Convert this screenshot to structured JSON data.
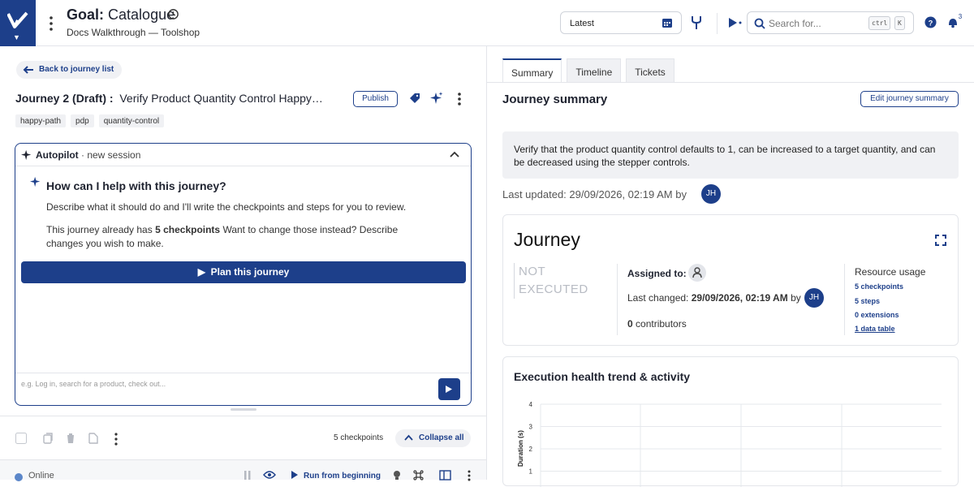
{
  "header": {
    "goal_label": "Goal:",
    "goal_name": "Catalogue",
    "subtitle": "Docs Walkthrough — Toolshop",
    "version_select": "Latest",
    "search_placeholder": "Search for...",
    "kbd_ctrl": "ctrl",
    "kbd_k": "K",
    "notification_count": "3",
    "brand_color": "#1d3f8a"
  },
  "left": {
    "back_label": "Back to journey list",
    "journey_prefix": "Journey 2 (Draft) :",
    "journey_name": "Verify Product Quantity Control Happy P...",
    "publish_label": "Publish",
    "tags": [
      "happy-path",
      "pdp",
      "quantity-control"
    ],
    "autopilot": {
      "title": "Autopilot",
      "session": "· new session",
      "question": "How can I help with this journey?",
      "intro": "Describe what it should do and I'll write the checkpoints and steps for you to review.",
      "existing_prefix": "This journey already has",
      "existing_count": "5 checkpoints",
      "existing_suffix": "Want to change those instead? Describe changes you wish to make.",
      "plan_label": "Plan this journey",
      "input_placeholder": "e.g. Log in, search for a product, check out..."
    },
    "toolbar": {
      "checkpoint_count": "5 checkpoints",
      "collapse_label": "Collapse all"
    },
    "status": {
      "online_label": "Online",
      "run_label": "Run from beginning"
    }
  },
  "right": {
    "tabs": [
      "Summary",
      "Timeline",
      "Tickets"
    ],
    "summary_title": "Journey summary",
    "edit_label": "Edit journey summary",
    "summary_text": "Verify that the product quantity control defaults to 1, can be increased to a target quantity, and can be decreased using the stepper controls.",
    "last_updated": "Last updated: 29/09/2026, 02:19 AM by",
    "avatar_initials": "JH",
    "card": {
      "title": "Journey",
      "status_line1": "NOT",
      "status_line2": "EXECUTED",
      "assigned_label": "Assigned to:",
      "last_changed_prefix": "Last changed:",
      "last_changed_value": "29/09/2026, 02:19 AM",
      "last_changed_by": "by",
      "contributors_count": "0",
      "contributors_label": "contributors",
      "resource_title": "Resource usage",
      "resources": [
        "5 checkpoints",
        "5 steps",
        "0 extensions",
        "1 data table"
      ]
    },
    "chart_title": "Execution health trend & activity"
  },
  "chart_data": {
    "type": "line",
    "title": "Execution health trend & activity",
    "ylabel": "Duration (s)",
    "yticks": [
      1,
      2,
      3,
      4
    ],
    "ylim": [
      0,
      4
    ],
    "grid": true,
    "series": []
  }
}
